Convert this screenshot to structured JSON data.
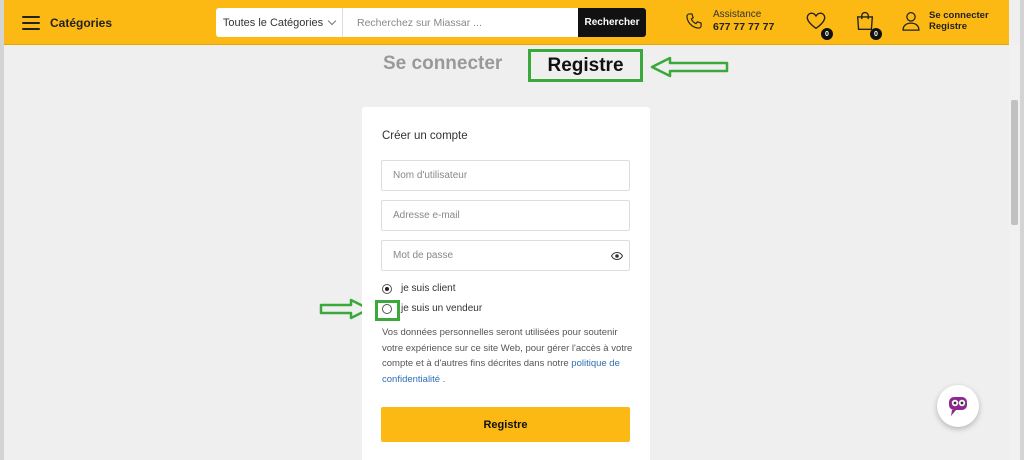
{
  "header": {
    "categories_label": "Catégories",
    "search_category": "Toutes le Catégories",
    "search_placeholder": "Recherchez sur Miassar ...",
    "search_button": "Rechercher",
    "assistance_label": "Assistance",
    "assistance_phone": "677 77 77 77",
    "wishlist_count": "0",
    "cart_count": "0",
    "account_line1": "Se connecter",
    "account_line2": "Registre",
    "icons": [
      "hamburger-icon",
      "chevron-down-icon",
      "phone-icon",
      "heart-icon",
      "shopping-bag-icon",
      "user-icon"
    ]
  },
  "tabs": {
    "login": "Se connecter",
    "register": "Registre"
  },
  "form": {
    "title": "Créer un compte",
    "username_placeholder": "Nom d'utilisateur",
    "email_placeholder": "Adresse e-mail",
    "password_placeholder": "Mot de passe",
    "role_client": "je suis client",
    "role_vendor": "je suis un vendeur",
    "privacy_text": "Vos données personnelles seront utilisées pour soutenir votre expérience sur ce site Web, pour gérer l'accès à votre compte et à d'autres fins décrites dans notre",
    "privacy_link": "politique de confidentialité",
    "privacy_end": ".",
    "submit": "Registre",
    "selected_role": "client"
  },
  "colors": {
    "brand_yellow": "#fdb913",
    "annotation_green": "#3aa83a",
    "link_blue": "#2f6fb5"
  }
}
